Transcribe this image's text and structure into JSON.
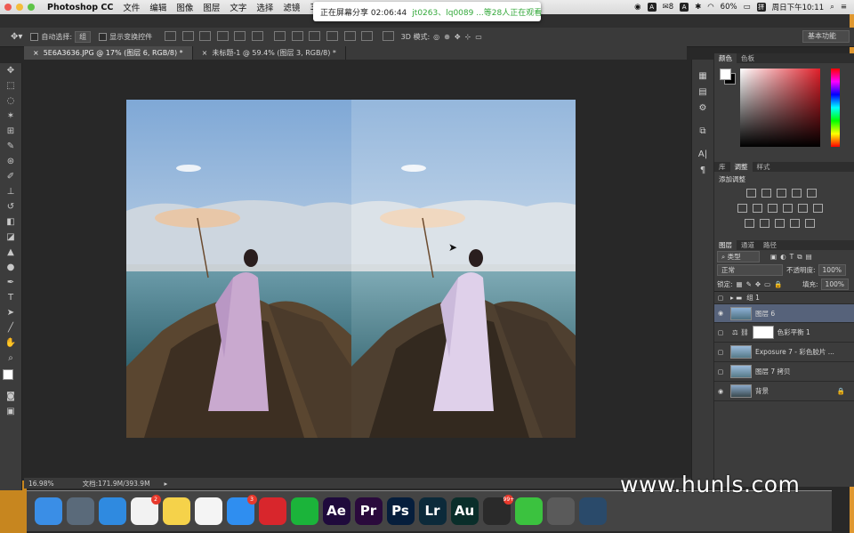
{
  "menubar": {
    "app_name": "Photoshop CC",
    "items": [
      "文件",
      "编辑",
      "图像",
      "图层",
      "文字",
      "选择",
      "滤镜",
      "3D"
    ],
    "battery": "60%",
    "clock": "周日下午10:11"
  },
  "share_banner": {
    "timer": "正在屏幕分享 02:06:44",
    "viewers": "jt0263、lq0089 ...等28人正在观看"
  },
  "options_bar": {
    "auto_select_label": "自动选择:",
    "auto_select_value": "组",
    "show_transform_label": "显示变换控件",
    "mode_3d_label": "3D 模式:",
    "workspace": "基本功能"
  },
  "doc_tabs": [
    {
      "label": "5E6A3636.JPG @ 17% (图层 6, RGB/8) *",
      "active": true
    },
    {
      "label": "未标题-1 @ 59.4% (图层 3, RGB/8) *",
      "active": false
    }
  ],
  "status_bar": {
    "zoom": "16.98%",
    "doc_size": "文档:171.9M/393.9M"
  },
  "color_panel": {
    "tabs": [
      "颜色",
      "色板"
    ],
    "foreground": "#ffffff",
    "background": "#000000",
    "hue_color": "#e0202a"
  },
  "adjust_panel": {
    "tabs": [
      "库",
      "调整",
      "样式"
    ],
    "title": "添加调整"
  },
  "layers_panel": {
    "tabs": [
      "图层",
      "通道",
      "路径"
    ],
    "filter": "类型",
    "blend_mode": "正常",
    "opacity_label": "不透明度:",
    "opacity_value": "100%",
    "lock_label": "锁定:",
    "fill_label": "填充:",
    "fill_value": "100%",
    "layers": [
      {
        "name": "组 1",
        "type": "group",
        "visible": false,
        "selected": false
      },
      {
        "name": "图层 6",
        "type": "image",
        "visible": true,
        "selected": true
      },
      {
        "name": "色彩平衡 1",
        "type": "adjustment",
        "visible": false,
        "selected": false
      },
      {
        "name": "Exposure 7 - 彩色胶片 ...",
        "type": "image",
        "visible": false,
        "selected": false
      },
      {
        "name": "图层 7 拷贝",
        "type": "image",
        "visible": false,
        "selected": false
      },
      {
        "name": "背景",
        "type": "background",
        "visible": true,
        "selected": false
      }
    ]
  },
  "dock": {
    "apps": [
      {
        "name": "finder-icon",
        "label": "",
        "color": "#3a8ee6"
      },
      {
        "name": "launchpad-icon",
        "label": "",
        "color": "#5a6a7a"
      },
      {
        "name": "safari-icon",
        "label": "",
        "color": "#2f8ae0"
      },
      {
        "name": "reminders-icon",
        "label": "",
        "color": "#f2f2f2",
        "badge": "2"
      },
      {
        "name": "notes-icon",
        "label": "",
        "color": "#f5d24a"
      },
      {
        "name": "photos-icon",
        "label": "",
        "color": "#f4f4f4"
      },
      {
        "name": "appstore-icon",
        "label": "",
        "color": "#2f8ef0",
        "badge": "3"
      },
      {
        "name": "netease-music-icon",
        "label": "",
        "color": "#d8262c"
      },
      {
        "name": "iqiyi-icon",
        "label": "",
        "color": "#1bb43a"
      },
      {
        "name": "after-effects-icon",
        "label": "Ae",
        "color": "#1f0a3c"
      },
      {
        "name": "premiere-icon",
        "label": "Pr",
        "color": "#2a0a3c"
      },
      {
        "name": "photoshop-icon",
        "label": "Ps",
        "color": "#061e3c"
      },
      {
        "name": "lightroom-icon",
        "label": "Lr",
        "color": "#0c2a3a"
      },
      {
        "name": "audition-icon",
        "label": "Au",
        "color": "#0a2e2a"
      },
      {
        "name": "qq-icon",
        "label": "",
        "color": "#2a2a2a",
        "badge": "99+"
      },
      {
        "name": "wechat-icon",
        "label": "",
        "color": "#3bc23f"
      },
      {
        "name": "screenshot-icon",
        "label": "",
        "color": "#5a5a5a"
      },
      {
        "name": "quicktime-icon",
        "label": "",
        "color": "#2a4a6a"
      }
    ]
  },
  "watermark": "www.hunls.com"
}
